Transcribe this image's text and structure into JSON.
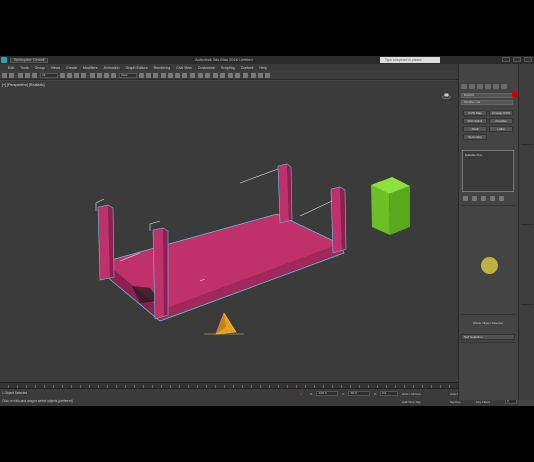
{
  "app": {
    "workspace_label": "Workspace: Default",
    "window_title": "Autodesk 3ds Max 2016    Untitled",
    "search_placeholder": "Type a keyword or phrase"
  },
  "menu": [
    "Edit",
    "Tools",
    "Group",
    "Views",
    "Create",
    "Modifiers",
    "Animation",
    "Graph Editors",
    "Rendering",
    "Civil View",
    "Customize",
    "Scripting",
    "Content",
    "Help"
  ],
  "toolbar": {
    "filter_value": "All",
    "view_value": "View"
  },
  "viewport": {
    "label": "[+] [Perspective] [Realistic]",
    "table_color": "#c0306a",
    "edge_color": "#5ac8e0",
    "box_color": "#7acc2e"
  },
  "command_panel": {
    "object_name": "Box001",
    "modifier_list": "Modifier List",
    "buttons": {
      "uvw_map": "UVW Map",
      "unwrap_uvw": "Unwrap UVW",
      "ffd": "FFD 2x2x2",
      "chamfer": "Chamfer",
      "shell": "Shell",
      "lathe": "Lathe",
      "symmetry": "Symmetry"
    },
    "stack_item": "Editable Poly",
    "whole_object": "Whole Object Selected",
    "soft_selection": "Soft Selection",
    "object_color": "#cc0000"
  },
  "status": {
    "selected": "1 Object Selected",
    "prompt": "Click or click-and-drag to select objects (preferred)",
    "welcome": "Welcome to M",
    "x_label": "X:",
    "x_value": "-100.0",
    "y_label": "Y:",
    "y_value": "-50.0",
    "z_label": "Z:",
    "z_value": "0.0",
    "grid": "Grid = 10.0cm",
    "add_time_tag": "Add Time Tag",
    "set_key": "Set Key",
    "auto_key": "Auto Key",
    "selected_dropdown": "Selected",
    "key_filters": "Key Filters...",
    "frame": "0"
  }
}
